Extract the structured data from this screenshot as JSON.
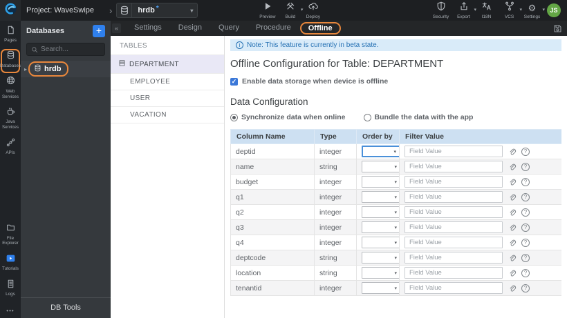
{
  "icons": {
    "caret-down-icon": "▾",
    "breadcrumb-chevron-icon": "›",
    "collapse-icon": "«",
    "expander-icon": "▸",
    "checkmark-icon": "✓",
    "more-icon": "•••",
    "info-icon": "i",
    "help-icon": "?",
    "add-icon": "+"
  },
  "topbar": {
    "project_label": "Project: WaveSwipe",
    "db_selector": {
      "value": "hrdb",
      "modified_indicator": "*"
    },
    "center_actions": [
      {
        "label": "Preview",
        "icon": "preview-play-icon",
        "has_caret": false
      },
      {
        "label": "Build",
        "icon": "build-hammers-icon",
        "has_caret": true
      },
      {
        "label": "Deploy",
        "icon": "deploy-cloud-icon",
        "has_caret": false
      }
    ],
    "right_actions": [
      {
        "label": "Security",
        "icon": "shield-icon",
        "has_caret": false
      },
      {
        "label": "Export",
        "icon": "export-icon",
        "has_caret": true
      },
      {
        "label": "I18N",
        "icon": "i18n-icon",
        "has_caret": false
      },
      {
        "label": "VCS",
        "icon": "vcs-branch-icon",
        "has_caret": true
      },
      {
        "label": "Settings",
        "icon": "gear-icon",
        "has_caret": true
      }
    ],
    "avatar_initials": "JS"
  },
  "sidebar": {
    "top_items": [
      {
        "label": "Pages",
        "icon": "pages-icon",
        "active": false
      },
      {
        "label": "Databases",
        "icon": "database-icon",
        "active": true
      },
      {
        "label": "Web Services",
        "icon": "globe-icon",
        "active": false
      },
      {
        "label": "Java Services",
        "icon": "coffee-icon",
        "active": false
      },
      {
        "label": "APIs",
        "icon": "api-icon",
        "active": false
      }
    ],
    "bottom_items": [
      {
        "label": "File Explorer",
        "icon": "folder-icon",
        "active": false
      },
      {
        "label": "Tutorials",
        "icon": "video-icon",
        "active": false
      },
      {
        "label": "Logs",
        "icon": "logs-icon",
        "active": false
      }
    ]
  },
  "db_panel": {
    "title": "Databases",
    "search_placeholder": "Search...",
    "tree_items": [
      {
        "label": "hrdb",
        "icon": "database-icon",
        "highlighted": true
      }
    ],
    "footer_button_label": "DB Tools"
  },
  "tabs": {
    "items": [
      {
        "label": "Settings",
        "active": false
      },
      {
        "label": "Design",
        "active": false
      },
      {
        "label": "Query",
        "active": false
      },
      {
        "label": "Procedure",
        "active": false
      },
      {
        "label": "Offline",
        "active": true
      }
    ]
  },
  "tables_panel": {
    "title": "TABLES",
    "items": [
      {
        "label": "DEPARTMENT",
        "selected": true,
        "icon": "table-icon"
      },
      {
        "label": "EMPLOYEE",
        "selected": false
      },
      {
        "label": "USER",
        "selected": false
      },
      {
        "label": "VACATION",
        "selected": false
      }
    ]
  },
  "main": {
    "note": "Note: This feature is currently in beta state.",
    "title": "Offline Configuration for Table: DEPARTMENT",
    "enable_checkbox_label": "Enable data storage when device is offline",
    "enable_checked": true,
    "section_title": "Data Configuration",
    "radio_options": [
      {
        "label": "Synchronize data when online",
        "selected": true
      },
      {
        "label": "Bundle the data with the app",
        "selected": false
      }
    ],
    "table": {
      "headers": [
        "Column Name",
        "Type",
        "Order by",
        "Filter Value"
      ],
      "filter_placeholder": "Field Value",
      "rows": [
        {
          "name": "deptid",
          "type": "integer",
          "order_by": "",
          "filter_value": "",
          "focused": true
        },
        {
          "name": "name",
          "type": "string",
          "order_by": "",
          "filter_value": "",
          "focused": false
        },
        {
          "name": "budget",
          "type": "integer",
          "order_by": "",
          "filter_value": "",
          "focused": false
        },
        {
          "name": "q1",
          "type": "integer",
          "order_by": "",
          "filter_value": "",
          "focused": false
        },
        {
          "name": "q2",
          "type": "integer",
          "order_by": "",
          "filter_value": "",
          "focused": false
        },
        {
          "name": "q3",
          "type": "integer",
          "order_by": "",
          "filter_value": "",
          "focused": false
        },
        {
          "name": "q4",
          "type": "integer",
          "order_by": "",
          "filter_value": "",
          "focused": false
        },
        {
          "name": "deptcode",
          "type": "string",
          "order_by": "",
          "filter_value": "",
          "focused": false
        },
        {
          "name": "location",
          "type": "string",
          "order_by": "",
          "filter_value": "",
          "focused": false
        },
        {
          "name": "tenantid",
          "type": "integer",
          "order_by": "",
          "filter_value": "",
          "focused": false
        }
      ]
    }
  },
  "colors": {
    "highlight_orange": "#e8873c",
    "accent_blue": "#2f80ed",
    "note_bg": "#d9ebf9",
    "note_text": "#2470b3",
    "table_header_bg": "#cde0f2",
    "focused_select_border": "#4a90d9",
    "avatar_green": "#63a645",
    "selected_table_row_bg": "#e9e8f6"
  }
}
